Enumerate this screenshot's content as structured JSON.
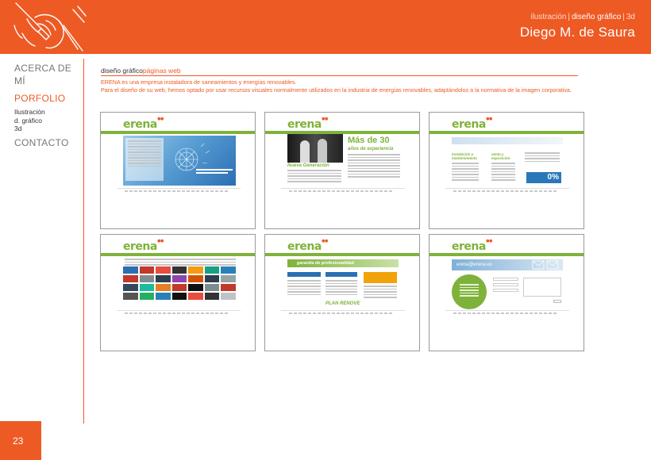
{
  "header": {
    "crumbs": [
      "ilustración",
      "diseño gráfico",
      "3d"
    ],
    "author": "Diego M. de Saura"
  },
  "nav": {
    "about": "ACERCA DE MÍ",
    "portfolio": "PORFOLIO",
    "subitems": [
      "Ilustración",
      "d. gráfico",
      "3d"
    ],
    "contact": "CONTACTO"
  },
  "section": {
    "category": "diseño gráfico",
    "current": "páginas web",
    "desc_line1": "ERENA es una empresa instaladora de saneamientos y energías renovables.",
    "desc_line2": "Para el diseño de su web, hemos optado por usar recursos visuales normalmente utilizados en la industria de energías renovables, adaptándolos a la normativa de la imagen corporativa."
  },
  "thumbnails": {
    "logo": "erena",
    "t2_heading": "Más de 30",
    "t2_subheading": "años de experiencia",
    "t2_caption": "Nueva Generación",
    "t3_col1": "instalación y mantenimiento",
    "t3_col2": "venta y exposición",
    "t3_badge": "0%",
    "t5_banner": "garantía de profesionalidad",
    "t5_bottom": "PLAN RENOVE",
    "t6_email": "erena@erena.es"
  },
  "page_number": "23",
  "colors": {
    "accent": "#ee5a24",
    "brand_green": "#7fb23a"
  }
}
